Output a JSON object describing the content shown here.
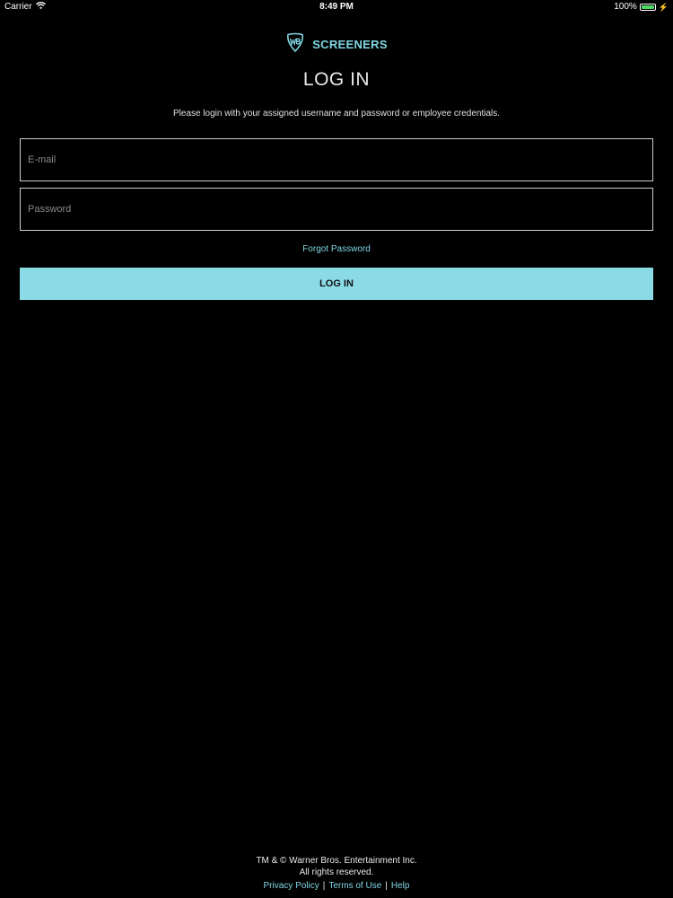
{
  "status_bar": {
    "carrier": "Carrier",
    "time": "8:49 PM",
    "battery": "100%",
    "battery_level": 1.0,
    "icons": [
      "wifi-icon",
      "battery-icon",
      "charging-bolt-icon"
    ]
  },
  "brand": {
    "logo_icon": "wb-shield-logo",
    "name": "SCREENERS",
    "accent_color": "#7fd6e2"
  },
  "login": {
    "title": "LOG IN",
    "instructions": "Please login with your assigned username and password or employee credentials.",
    "email_placeholder": "E-mail",
    "email_value": "",
    "password_placeholder": "Password",
    "password_value": "",
    "forgot_password": "Forgot Password",
    "submit_label": "LOG IN",
    "button_color": "#8adbe6"
  },
  "footer": {
    "copyright": "TM & © Warner Bros. Entertainment Inc.",
    "rights": "All rights reserved.",
    "links": [
      "Privacy Policy",
      "Terms of Use",
      "Help"
    ]
  }
}
